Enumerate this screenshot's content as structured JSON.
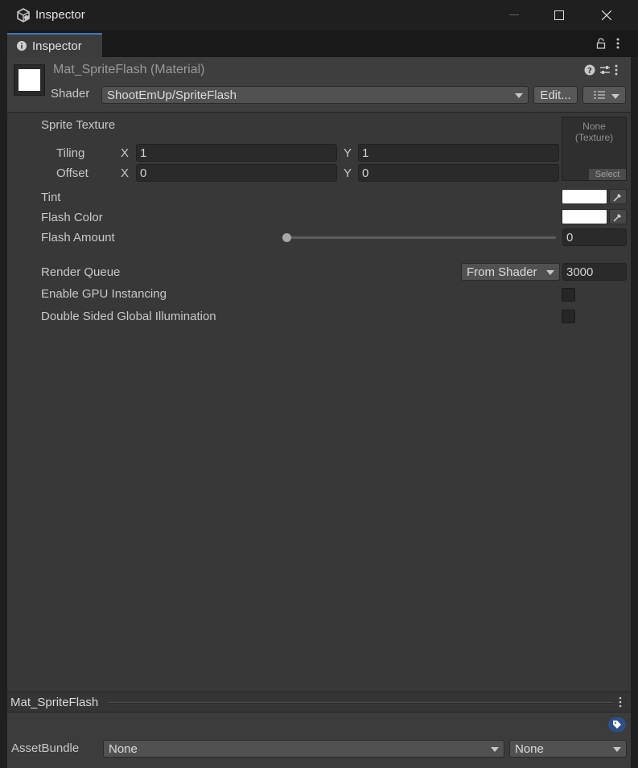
{
  "window": {
    "title": "Inspector"
  },
  "tab": {
    "label": "Inspector"
  },
  "header": {
    "material_name": "Mat_SpriteFlash (Material)",
    "shader_label": "Shader",
    "shader_value": "ShootEmUp/SpriteFlash",
    "edit_button": "Edit..."
  },
  "properties": {
    "sprite_texture": {
      "label": "Sprite Texture",
      "slot_line1": "None",
      "slot_line2": "(Texture)",
      "select": "Select"
    },
    "tiling": {
      "label": "Tiling",
      "x_axis": "X",
      "x": "1",
      "y_axis": "Y",
      "y": "1"
    },
    "offset": {
      "label": "Offset",
      "x_axis": "X",
      "x": "0",
      "y_axis": "Y",
      "y": "0"
    },
    "tint": {
      "label": "Tint",
      "color": "#ffffff"
    },
    "flash_color": {
      "label": "Flash Color",
      "color": "#ffffff"
    },
    "flash_amount": {
      "label": "Flash Amount",
      "value": "0",
      "fraction": 0
    },
    "render_queue": {
      "label": "Render Queue",
      "mode": "From Shader",
      "value": "3000"
    },
    "gpu_instancing": {
      "label": "Enable GPU Instancing",
      "checked": false
    },
    "double_sided_gi": {
      "label": "Double Sided Global Illumination",
      "checked": false
    }
  },
  "footer": {
    "asset_name": "Mat_SpriteFlash",
    "assetbundle_label": "AssetBundle",
    "bundle_name": "None",
    "bundle_variant": "None"
  },
  "colors": {
    "accent": "#3a79bb",
    "panel": "#383838",
    "tag": "#2c4f8a"
  },
  "icons": [
    "unity-cube-icon",
    "info-icon",
    "lock-icon",
    "kebab-icon",
    "help-icon",
    "preset-icon",
    "eyedropper-icon",
    "tag-icon"
  ]
}
